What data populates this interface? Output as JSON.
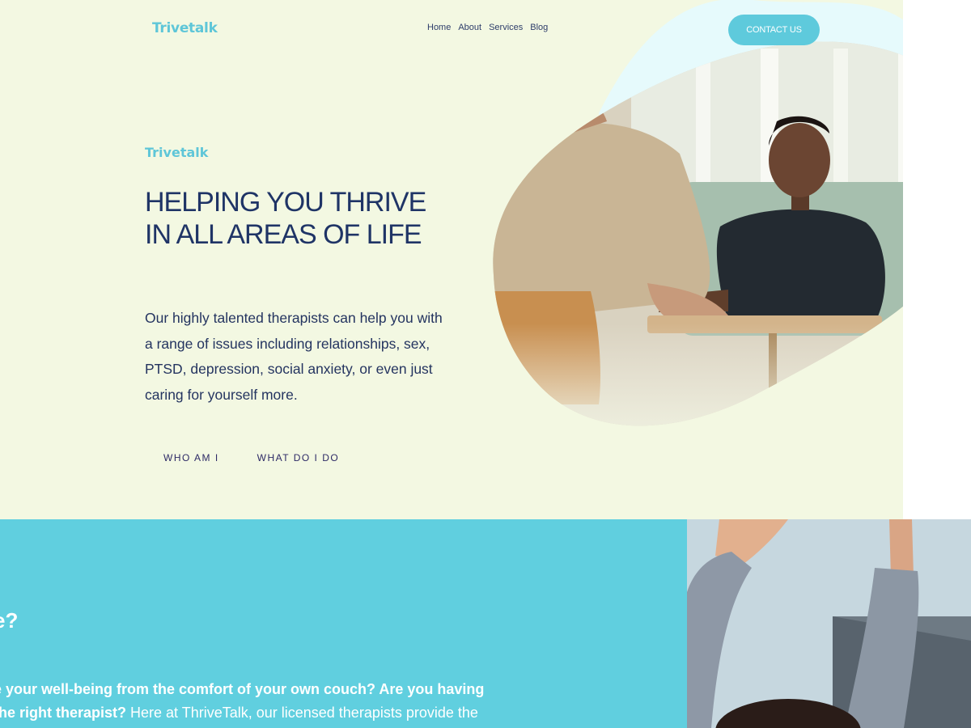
{
  "header": {
    "logo": "Trivetalk",
    "nav": [
      "Home",
      "About",
      "Services",
      "Blog"
    ],
    "contact_label": "CONTACT US"
  },
  "hero": {
    "eyebrow": "Trivetalk",
    "headline_line1": "HELPING YOU THRIVE",
    "headline_line2": "IN ALL AREAS OF LIFE",
    "body": "Our highly talented therapists can help you with a range of issues including relationships, sex, PTSD, depression, social anxiety, or even just caring for yourself more.",
    "links": [
      "WHO AM I",
      "WHAT DO I DO"
    ]
  },
  "band": {
    "heading": "e?",
    "line1_bold": "e your well-being from the comfort of your own couch? Are you having",
    "line2_bold": "the right therapist?",
    "line2_rest": " Here at ThriveTalk, our licensed therapists provide the"
  },
  "colors": {
    "hero_bg": "#f3f8e2",
    "accent": "#5ecadc",
    "navy": "#1f3466",
    "band_bg": "#60cfdf"
  }
}
